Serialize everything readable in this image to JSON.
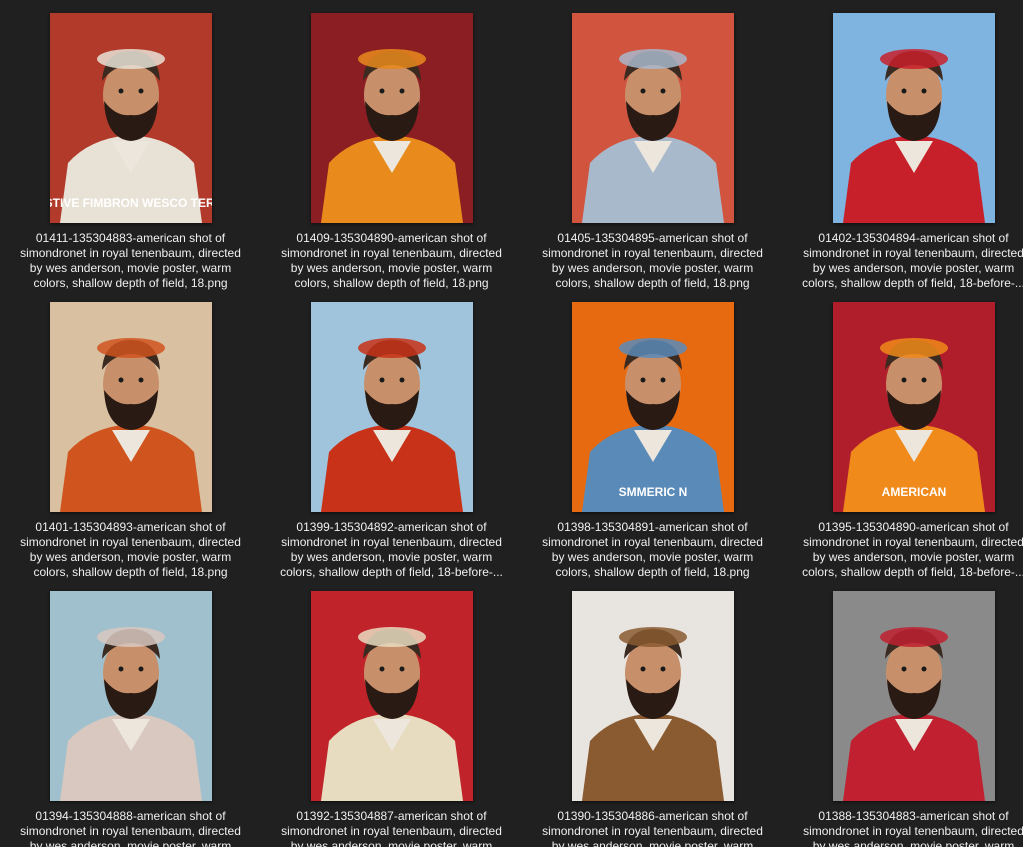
{
  "files": [
    {
      "caption": "01411-135304883-american shot of\nsimondronet in royal tenenbaum, directed\nby wes anderson, movie poster, warm\ncolors, shallow depth of field, 18.png",
      "bg": "#b23a2a",
      "accent": "#e8e2d6",
      "poster_text": "FESTIVE FIMBRON WESCO TERON"
    },
    {
      "caption": "01409-135304890-american shot of\nsimondronet in royal tenenbaum, directed\nby wes anderson, movie poster, warm\ncolors, shallow depth of field, 18.png",
      "bg": "#8a1e22",
      "accent": "#e88a1c",
      "poster_text": ""
    },
    {
      "caption": "01405-135304895-american shot of\nsimondronet in royal tenenbaum, directed\nby wes anderson, movie poster, warm\ncolors, shallow depth of field, 18.png",
      "bg": "#d0543e",
      "accent": "#a9b9cc",
      "poster_text": ""
    },
    {
      "caption": "01402-135304894-american shot of\nsimondronet in royal tenenbaum, directed\nby wes anderson, movie poster, warm\ncolors, shallow depth of field, 18-before-...",
      "bg": "#7fb3e0",
      "accent": "#c8202a",
      "poster_text": ""
    },
    {
      "caption": "01401-135304893-american shot of\nsimondronet in royal tenenbaum, directed\nby wes anderson, movie poster, warm\ncolors, shallow depth of field, 18.png",
      "bg": "#d8c0a0",
      "accent": "#d0541e",
      "poster_text": ""
    },
    {
      "caption": "01399-135304892-american shot of\nsimondronet in royal tenenbaum, directed\nby wes anderson, movie poster, warm\ncolors, shallow depth of field, 18-before-...",
      "bg": "#9fc4dc",
      "accent": "#c83218",
      "poster_text": ""
    },
    {
      "caption": "01398-135304891-american shot of\nsimondronet in royal tenenbaum, directed\nby wes anderson, movie poster, warm\ncolors, shallow depth of field, 18.png",
      "bg": "#e86a10",
      "accent": "#5a8ab8",
      "poster_text": "SMMERIC N"
    },
    {
      "caption": "01395-135304890-american shot of\nsimondronet in royal tenenbaum, directed\nby wes anderson, movie poster, warm\ncolors, shallow depth of field, 18-before-...",
      "bg": "#b01e2c",
      "accent": "#f08a1a",
      "poster_text": "AMERICAN"
    },
    {
      "caption": "01394-135304888-american shot of\nsimondronet in royal tenenbaum, directed\nby wes anderson, movie poster, warm",
      "bg": "#9fc0cc",
      "accent": "#d8c8c0",
      "poster_text": ""
    },
    {
      "caption": "01392-135304887-american shot of\nsimondronet in royal tenenbaum, directed\nby wes anderson, movie poster, warm",
      "bg": "#c0242a",
      "accent": "#e8dcc0",
      "poster_text": ""
    },
    {
      "caption": "01390-135304886-american shot of\nsimondronet in royal tenenbaum, directed\nby wes anderson, movie poster, warm",
      "bg": "#e8e4e0",
      "accent": "#8a5a30",
      "poster_text": ""
    },
    {
      "caption": "01388-135304883-american shot of\nsimondronet in royal tenenbaum, directed\nby wes anderson, movie poster, warm",
      "bg": "#8a8a8a",
      "accent": "#c02030",
      "poster_text": ""
    }
  ],
  "theme": {
    "background": "#202020",
    "text": "#f0f0f0",
    "skin": "#c8906a",
    "beard": "#2a1a14"
  }
}
